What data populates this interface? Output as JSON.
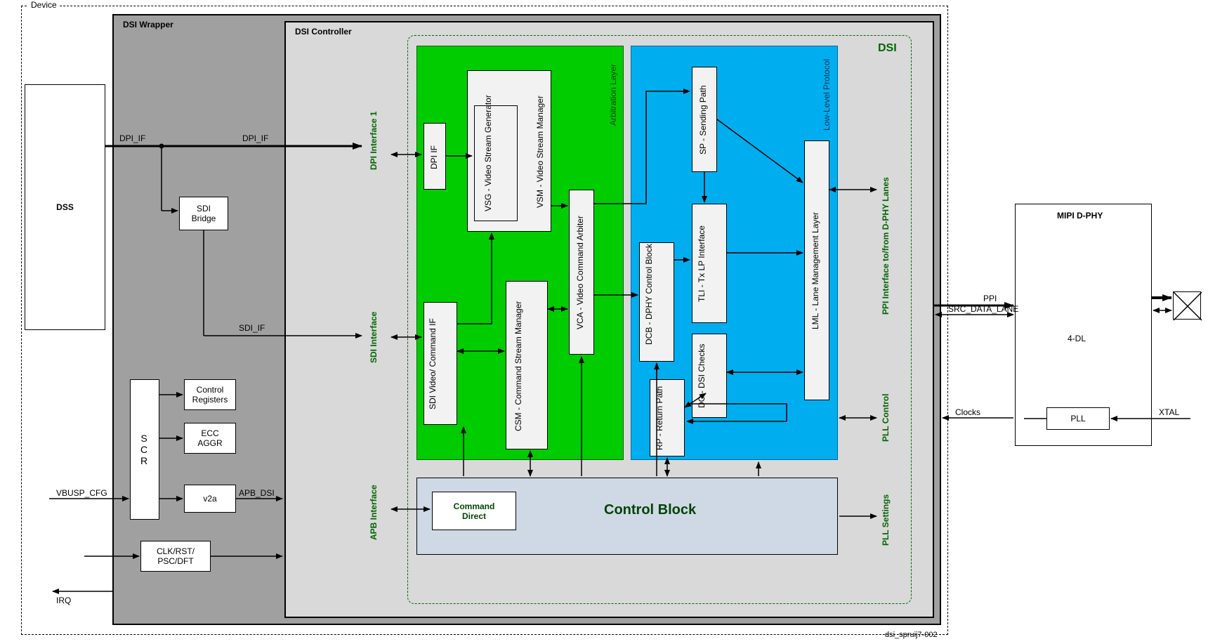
{
  "frame": {
    "device": "Device",
    "dsi_wrapper": "DSI Wrapper",
    "dsi_controller": "DSI Controller",
    "dsi": "DSI",
    "mipi_dphy": "MIPI D-PHY"
  },
  "left": {
    "dss": "DSS",
    "sdi_bridge": "SDI\nBridge",
    "control_registers": "Control\nRegisters",
    "scr": "S\nC\nR",
    "ecc_aggr": "ECC\nAGGR",
    "v2a": "v2a",
    "clk_rst": "CLK/RST/\nPSC/DFT"
  },
  "signals": {
    "dpi_if_left": "DPI_IF",
    "dpi_if_right": "DPI_IF",
    "sdi_if": "SDI_IF",
    "vbusp_cfg": "VBUSP_CFG",
    "apb_dsi": "APB_DSI",
    "irq": "IRQ",
    "ppi": "PPI",
    "src_data_lane": "SRC_DATA_LANE",
    "clocks": "Clocks",
    "xtal": "XTAL"
  },
  "interfaces": {
    "dpi1": "DPI Interface 1",
    "sdi": "SDI Interface",
    "apb": "APB Interface",
    "ppi": "PPI Interface to/from D-PHY Lanes",
    "pll_ctrl": "PLL Control",
    "pll_settings": "PLL Settings"
  },
  "arbit": {
    "title": "Arbitration Layer",
    "dpi_if": "DPI IF",
    "vsg": "VSG - Video\nStream Generator",
    "vsm": "VSM - Video Stream Manager",
    "vca": "VCA - Video Command Arbiter",
    "sdi_video": "SDI Video/\nCommand IF",
    "csm": "CSM - Command Stream\nManager"
  },
  "llp": {
    "title": "Low-Level Protocol",
    "sp": "SP - Sending Path",
    "dcb": "DCB - DPHY\nControl Block",
    "tli": "TLI - Tx LP\nInterface",
    "dc": "DC - DSI\nChecks",
    "rp": "RP - Return\nPath",
    "lml": "LML - Lane Management Layer"
  },
  "ctrl": {
    "command_direct": "Command\nDirect",
    "control_block": "Control Block"
  },
  "dphy": {
    "four_dl": "4-DL",
    "pll": "PLL"
  },
  "footer": "dsi_spruij7-002"
}
